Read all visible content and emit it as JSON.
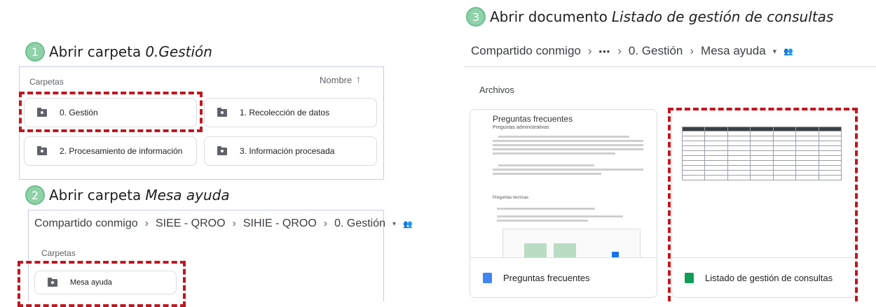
{
  "steps": [
    {
      "num": "1",
      "text": "Abrir carpeta ",
      "target": "0.Gestión"
    },
    {
      "num": "2",
      "text": "Abrir carpeta ",
      "target": "Mesa ayuda"
    },
    {
      "num": "3",
      "text": "Abrir documento ",
      "target": "Listado de gestión de consultas"
    }
  ],
  "panel1": {
    "header": "Carpetas",
    "sort_label": "Nombre",
    "sort_icon": "arrow-up-icon",
    "folders": [
      "0. Gestión",
      "1. Recolección de datos",
      "2. Procesamiento de información",
      "3. Información procesada"
    ]
  },
  "panel2": {
    "breadcrumb": [
      "Compartido conmigo",
      "SIEE - QROO",
      "SIHIE - QROO",
      "0. Gestión"
    ],
    "header": "Carpetas",
    "folders": [
      "Mesa ayuda"
    ]
  },
  "panel3": {
    "breadcrumb": [
      "Compartido conmigo",
      "•••",
      "0. Gestión",
      "Mesa ayuda"
    ],
    "header": "Archivos",
    "files": [
      {
        "name": "Preguntas frecuentes",
        "icon": "docs-icon",
        "color": "#4285f4"
      },
      {
        "name": "Listado de gestión de consultas",
        "icon": "sheets-icon",
        "color": "#0f9d58"
      }
    ],
    "preview": {
      "title": "Preguntas frecuentes",
      "subtitle": "Preguntas administrativas",
      "section2": "Preguntas técnicas"
    }
  },
  "colors": {
    "dash": "#c0161f",
    "badge": "#8fd1a8"
  }
}
